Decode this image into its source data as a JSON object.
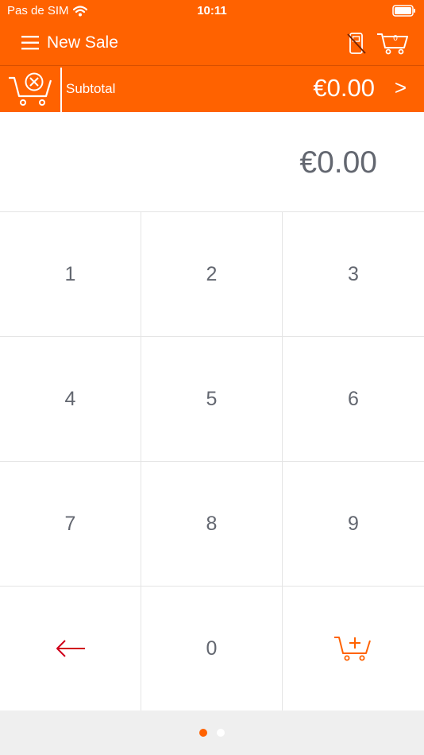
{
  "status_bar": {
    "carrier": "Pas de SIM",
    "time": "10:11"
  },
  "nav": {
    "title": "New Sale",
    "cart_count": "0"
  },
  "subtotal": {
    "label": "Subtotal",
    "amount": "€0.00",
    "chevron": ">"
  },
  "display": {
    "amount": "€0.00"
  },
  "keypad": {
    "keys": [
      "1",
      "2",
      "3",
      "4",
      "5",
      "6",
      "7",
      "8",
      "9"
    ],
    "zero": "0"
  },
  "colors": {
    "brand": "#ff6200",
    "text_gray": "#636770",
    "back_arrow": "#d0021b",
    "pager_bg": "#efefef"
  },
  "icons": {
    "menu": "hamburger-menu-icon",
    "card_reader": "card-reader-disconnected-icon",
    "cart": "shopping-cart-icon",
    "clear_cart": "clear-cart-icon",
    "back": "backspace-arrow-icon",
    "add_to_cart": "add-to-cart-icon"
  },
  "pager": {
    "pages": 2,
    "current": 1
  }
}
